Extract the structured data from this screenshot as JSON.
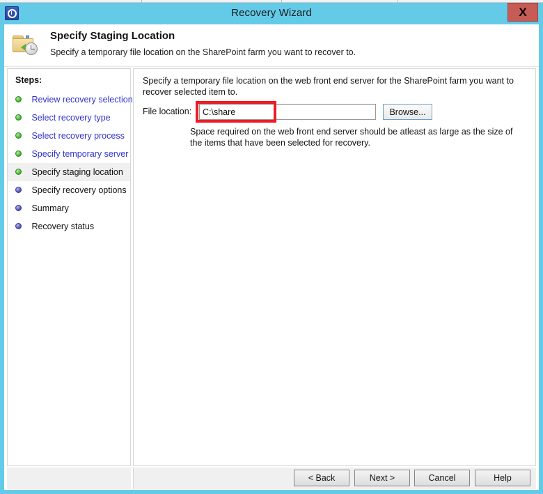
{
  "window": {
    "title": "Recovery Wizard",
    "close_label": "X",
    "title_icon": "recovery-clock-icon",
    "accent_color": "#63cbe8",
    "close_color": "#c75b56"
  },
  "header": {
    "icon": "folder-restore-icon",
    "title": "Specify Staging Location",
    "subtitle": "Specify a temporary file location on the SharePoint farm you want to recover to."
  },
  "sidebar": {
    "heading": "Steps:",
    "items": [
      {
        "label": "Review recovery selection",
        "state": "done",
        "bullet": "green-bullet-icon"
      },
      {
        "label": "Select recovery type",
        "state": "done",
        "bullet": "green-bullet-icon"
      },
      {
        "label": "Select recovery process",
        "state": "done",
        "bullet": "green-bullet-icon"
      },
      {
        "label": "Specify temporary server",
        "state": "done",
        "bullet": "green-bullet-icon"
      },
      {
        "label": "Specify staging location",
        "state": "current",
        "bullet": "green-bullet-icon"
      },
      {
        "label": "Specify recovery options",
        "state": "todo",
        "bullet": "blue-bullet-icon"
      },
      {
        "label": "Summary",
        "state": "todo",
        "bullet": "blue-bullet-icon"
      },
      {
        "label": "Recovery status",
        "state": "todo",
        "bullet": "blue-bullet-icon"
      }
    ]
  },
  "content": {
    "intro": "Specify a temporary file location on the web front end server for the SharePoint farm you want to recover selected item to.",
    "field_label": "File location:",
    "file_location_value": "C:\\share",
    "file_location_placeholder": "",
    "browse_label": "Browse...",
    "hint": "Space required on the web front end server should be atleast as large as the size of the items that have been selected for recovery.",
    "annotation_color": "#ed1c24"
  },
  "footer": {
    "back_label": "< Back",
    "next_label": "Next >",
    "cancel_label": "Cancel",
    "help_label": "Help"
  }
}
